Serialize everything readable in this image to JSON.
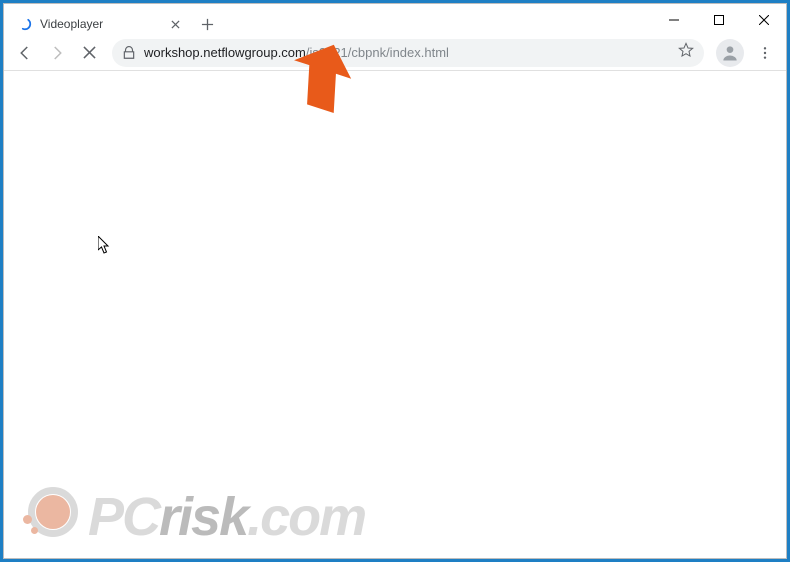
{
  "tab": {
    "title": "Videoplayer"
  },
  "toolbar": {
    "url_host": "workshop.netflowgroup.com",
    "url_path": "/js2/t21/cbpnk/index.html"
  },
  "watermark": {
    "pc": "PC",
    "risk": "risk",
    "com": ".com"
  }
}
